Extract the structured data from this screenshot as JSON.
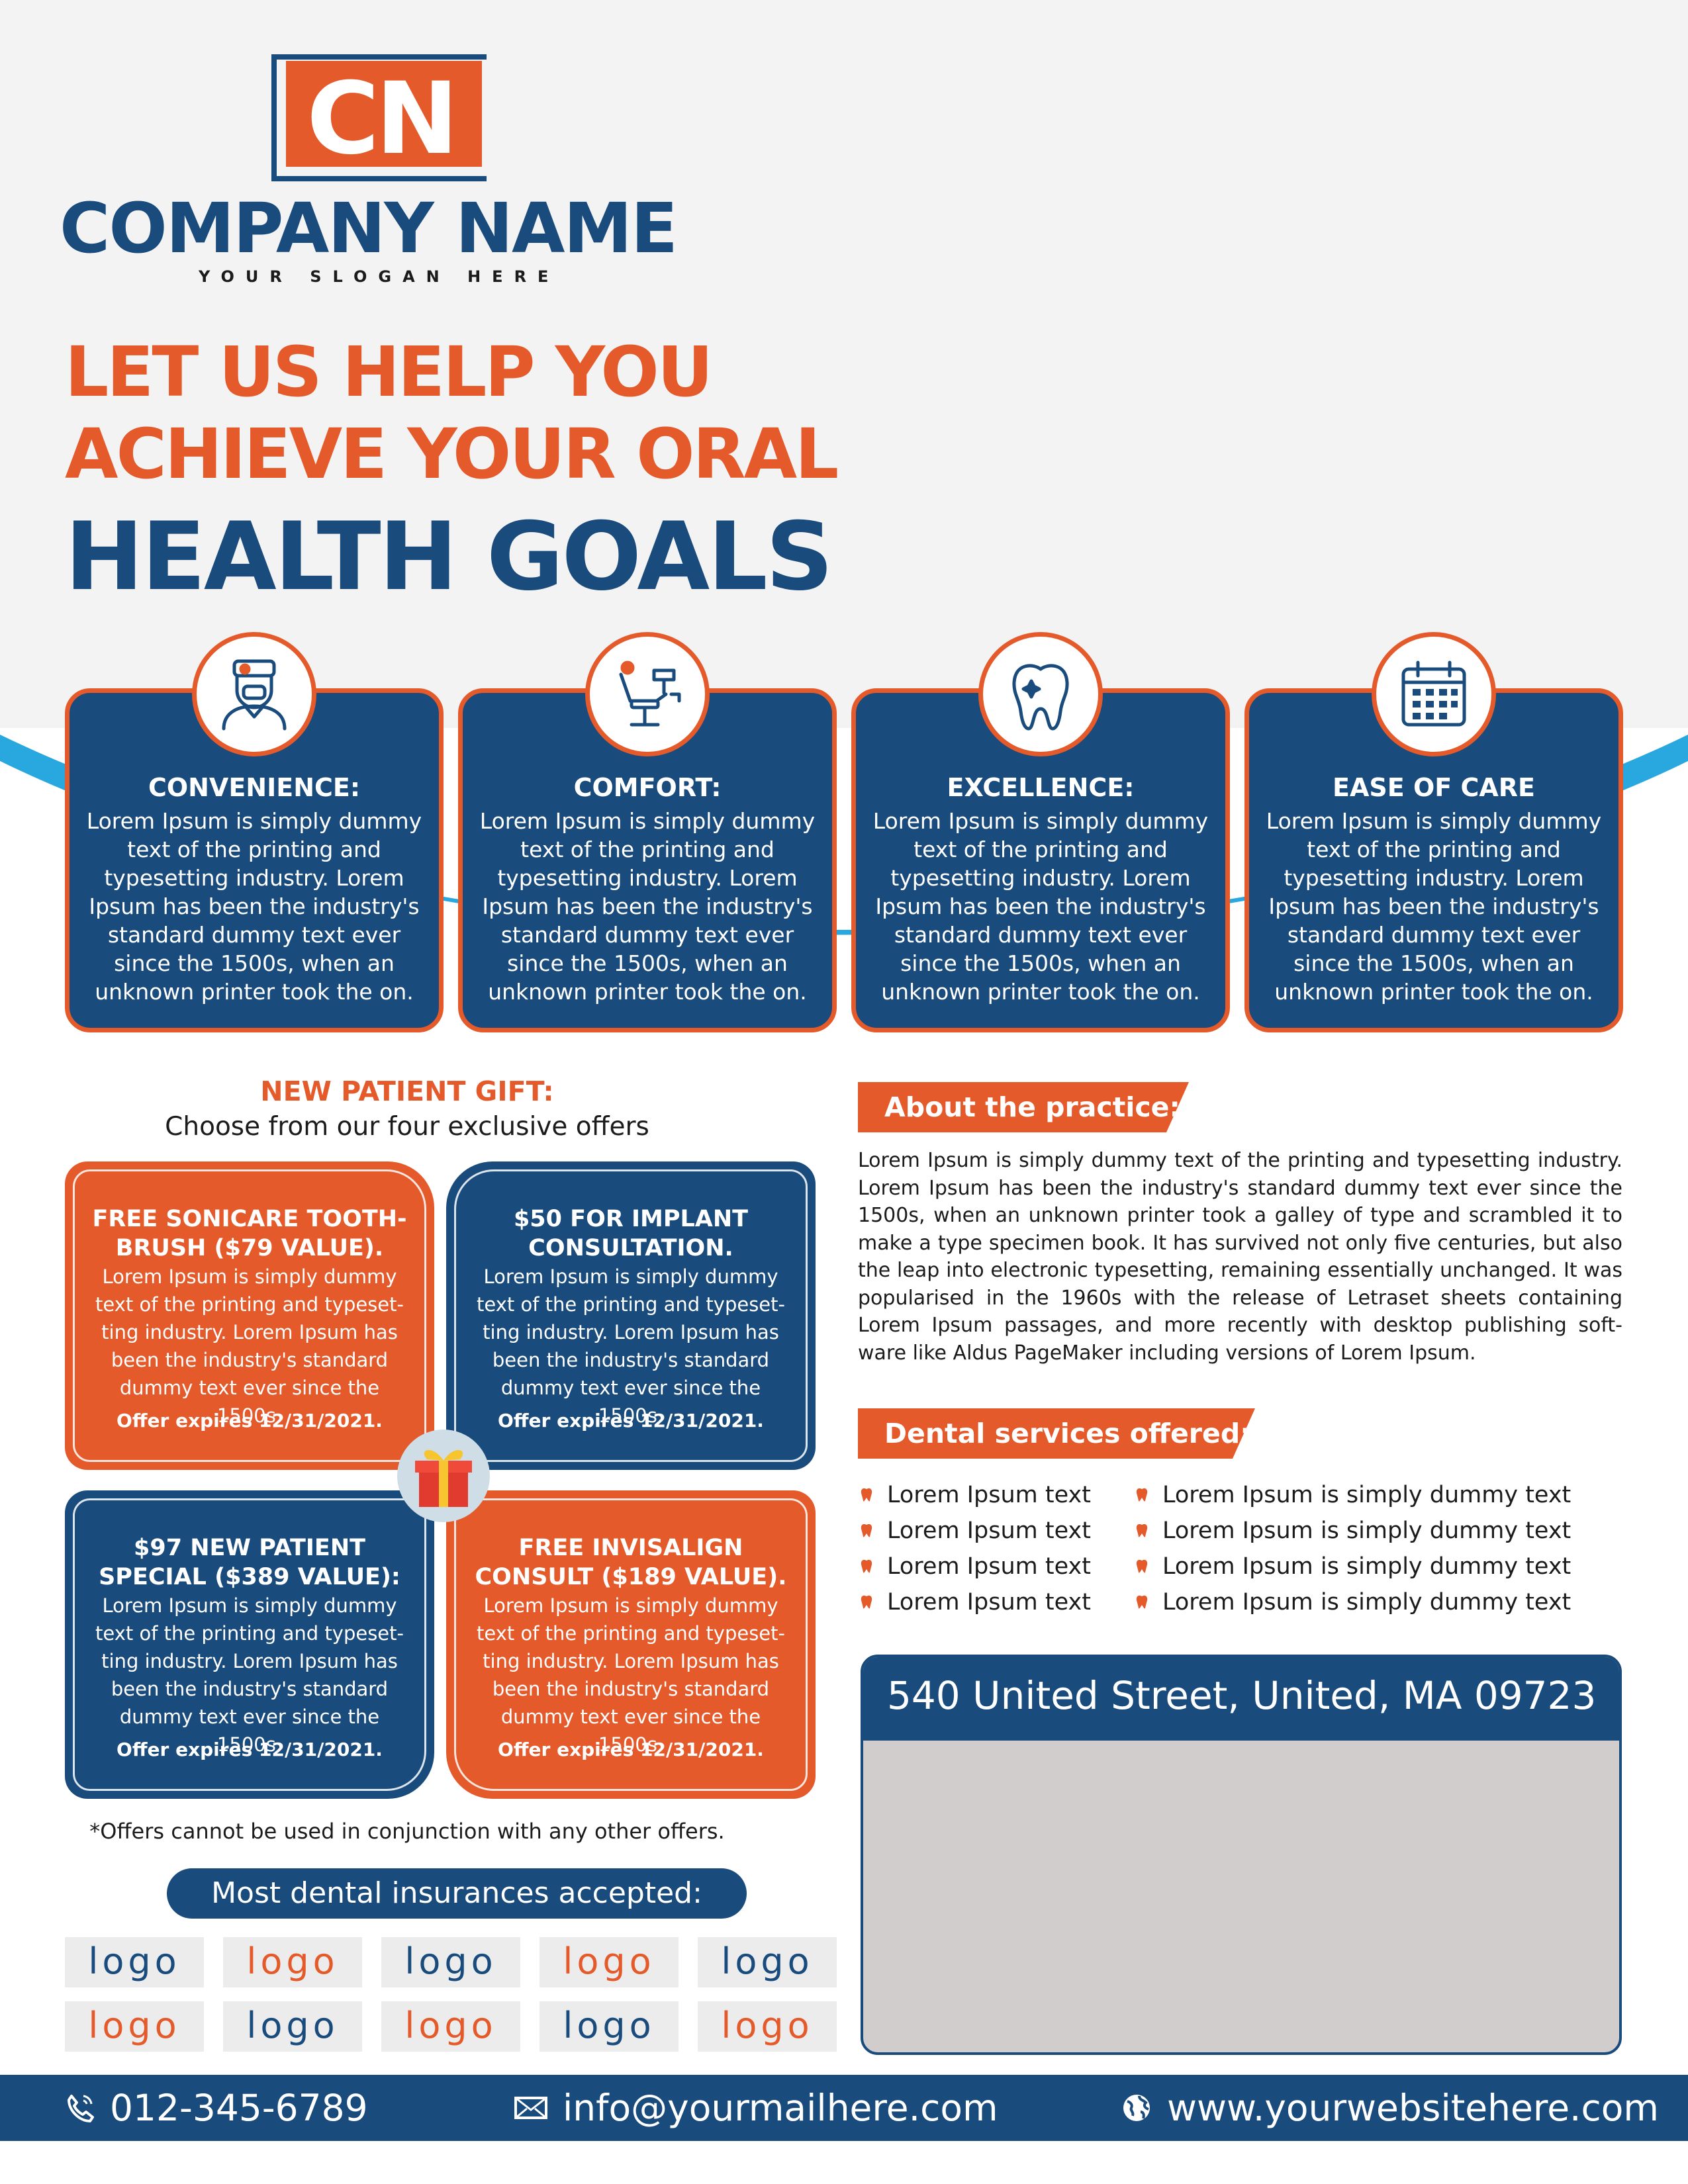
{
  "colors": {
    "navy": "#1a4b7d",
    "orange": "#e55a2a",
    "light_blue": "#29a8e0",
    "grey": "#d1cdcd"
  },
  "brand": {
    "logo_text": "CN",
    "company_name": "COMPANY NAME",
    "slogan": "YOUR SLOGAN HERE"
  },
  "headline": {
    "line1": "LET US HELP YOU",
    "line2": "ACHIEVE YOUR ORAL",
    "line3": "HEALTH GOALS"
  },
  "features": [
    {
      "icon": "dentist-icon",
      "title": "CONVENIENCE:",
      "body": "Lorem Ipsum is simply dummy text of the printing and typesetting industry. Lorem Ipsum has been the industry's standard dummy text ever since the 1500s, when an unknown printer took the on."
    },
    {
      "icon": "dental-chair-icon",
      "title": "COMFORT:",
      "body": "Lorem Ipsum is simply dummy text of the printing and typesetting industry. Lorem Ipsum has been the industry's standard dummy text ever since the 1500s, when an unknown printer took the on."
    },
    {
      "icon": "tooth-icon",
      "title": "EXCELLENCE:",
      "body": "Lorem Ipsum is simply dummy text of the printing and typesetting industry. Lorem Ipsum has been the industry's standard dummy text ever since the 1500s, when an unknown printer took the on."
    },
    {
      "icon": "calendar-icon",
      "title": "EASE OF CARE",
      "body": "Lorem Ipsum is simply dummy text of the printing and typesetting industry. Lorem Ipsum has been the industry's standard dummy text ever since the 1500s, when an unknown printer took the on."
    }
  ],
  "gift": {
    "title": "NEW PATIENT GIFT:",
    "subtitle": "Choose from our four exclusive offers",
    "offers": [
      {
        "title": "FREE SONICARE TOOTH-BRUSH ($79 VALUE).",
        "body": "Lorem Ipsum is simply dummy text of the printing and typeset-ting industry. Lorem Ipsum has been the industry's standard dummy text ever since the 1500s.",
        "expires": "Offer expires 12/31/2021."
      },
      {
        "title": "$50 FOR IMPLANT CONSULTATION.",
        "body": "Lorem Ipsum is simply dummy text of the printing and typeset-ting industry. Lorem Ipsum has been the industry's standard dummy text ever since the 1500s.",
        "expires": "Offer expires 12/31/2021."
      },
      {
        "title": "$97 NEW PATIENT SPECIAL ($389 VALUE):",
        "body": "Lorem Ipsum is simply dummy text of the printing and typeset-ting industry. Lorem Ipsum has been the industry's standard dummy text ever since the 1500s.",
        "expires": "Offer expires 12/31/2021."
      },
      {
        "title": "FREE INVISALIGN CONSULT ($189 VALUE).",
        "body": "Lorem Ipsum is simply dummy text of the printing and typeset-ting industry. Lorem Ipsum has been the industry's standard dummy text ever since the 1500s.",
        "expires": "Offer expires 12/31/2021."
      }
    ],
    "note": "*Offers cannot be used in conjunction with any other offers."
  },
  "insurance": {
    "label": "Most dental insurances accepted:",
    "logos": [
      "logo",
      "logo",
      "logo",
      "logo",
      "logo",
      "logo",
      "logo",
      "logo",
      "logo",
      "logo"
    ]
  },
  "about": {
    "label": "About the practice:",
    "body": "Lorem Ipsum is simply dummy text of the printing and typesetting industry. Lorem Ipsum has been the industry's standard dummy text ever since the 1500s, when an unknown printer took a galley of type and scrambled it to make a type specimen book. It has survived not only five centuries, but also the leap into electronic typesetting, remaining essentially unchanged. It was popularised in the 1960s with the release of Letraset sheets containing Lorem Ipsum passages, and more recently with desktop publishing soft-ware like Aldus PageMaker including versions of Lorem Ipsum."
  },
  "services": {
    "label": "Dental services offered:",
    "col1": [
      "Lorem Ipsum text",
      "Lorem Ipsum text",
      "Lorem Ipsum text",
      "Lorem Ipsum text"
    ],
    "col2": [
      "Lorem Ipsum is simply dummy text",
      "Lorem Ipsum is simply dummy text",
      "Lorem Ipsum is simply dummy text",
      "Lorem Ipsum is simply dummy text"
    ]
  },
  "address": "540 United Street, United, MA 09723",
  "footer": {
    "phone": "012-345-6789",
    "email": "info@yourmailhere.com",
    "website": "www.yourwebsitehere.com"
  }
}
